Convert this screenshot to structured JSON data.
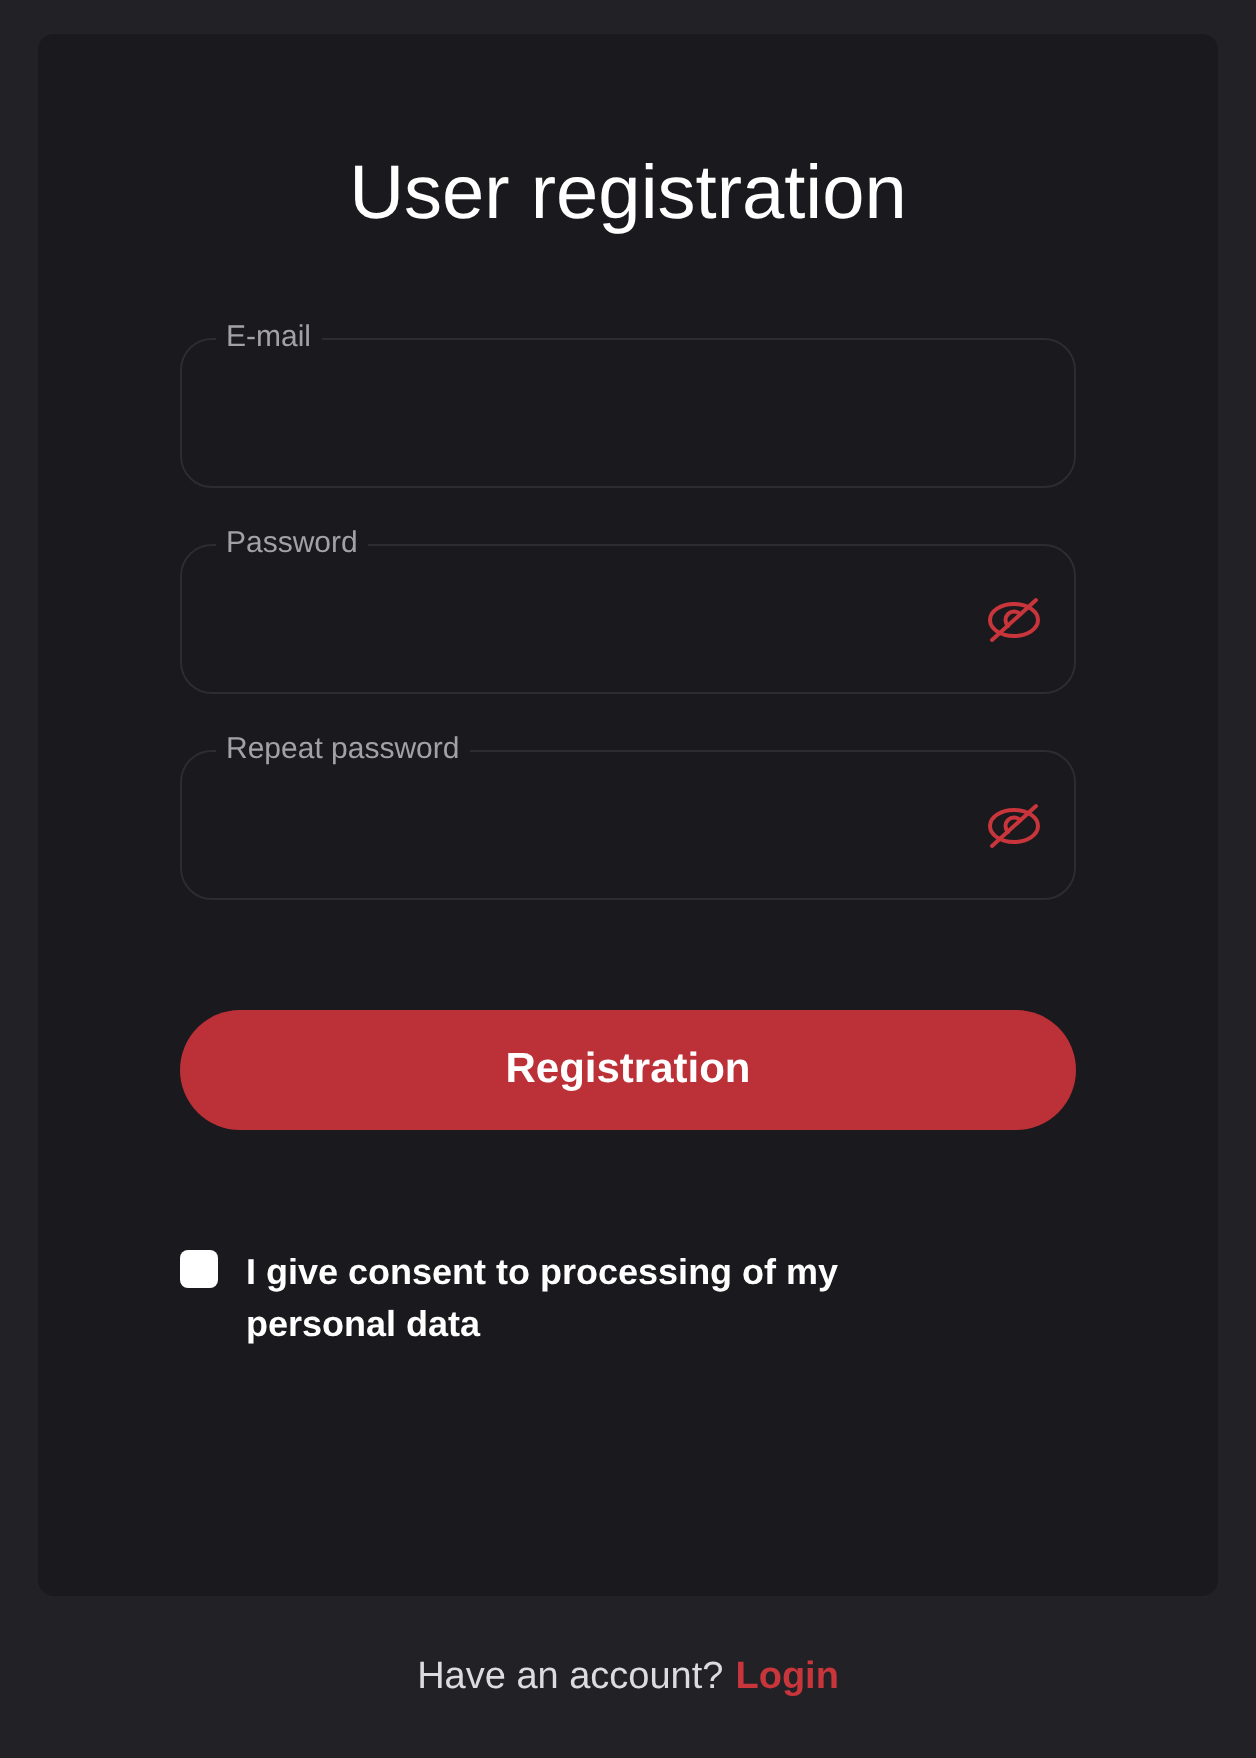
{
  "form": {
    "title": "User registration",
    "fields": [
      {
        "kind": "text",
        "label": "E-mail"
      },
      {
        "kind": "password",
        "label": "Password"
      },
      {
        "kind": "password",
        "label": "Repeat password"
      }
    ],
    "submit": "Registration",
    "consent": {
      "checked": false,
      "label": "I give consent to processing of my personal data"
    }
  },
  "footer": {
    "prompt": "Have an account?",
    "link": "Login"
  }
}
